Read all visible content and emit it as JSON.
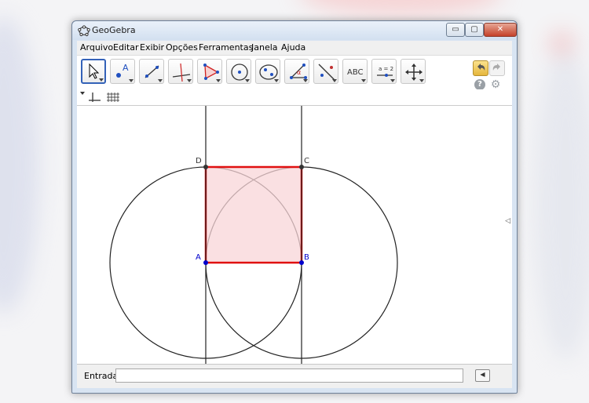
{
  "window": {
    "title": "GeoGebra",
    "controls": {
      "minimize": "▭",
      "maximize": "▢",
      "close": "✕"
    }
  },
  "menu": {
    "items": [
      "Arquivo",
      "Editar",
      "Exibir",
      "Opções",
      "Ferramentas",
      "Janela",
      "Ajuda"
    ]
  },
  "toolbar": {
    "tools": [
      {
        "icon": "move-arrow-icon",
        "active": true
      },
      {
        "icon": "new-point-icon"
      },
      {
        "icon": "line-icon"
      },
      {
        "icon": "perpendicular-line-icon"
      },
      {
        "icon": "polygon-icon"
      },
      {
        "icon": "circle-icon"
      },
      {
        "icon": "ellipse-icon"
      },
      {
        "icon": "angle-icon",
        "symbol": "α"
      },
      {
        "icon": "reflect-icon"
      },
      {
        "icon": "text-icon",
        "label": "ABC"
      },
      {
        "icon": "slider-icon",
        "label": "a = 2"
      },
      {
        "icon": "move-view-icon"
      }
    ],
    "undo_icon": "undo-icon",
    "redo_icon": "redo-icon",
    "help": "?",
    "settings": "⚙"
  },
  "graphics": {
    "points": [
      {
        "name": "A",
        "x": 0,
        "y": 0,
        "color": "#0000cc"
      },
      {
        "name": "B",
        "x": 1,
        "y": 0,
        "color": "#0000cc"
      },
      {
        "name": "C",
        "x": 1,
        "y": 1,
        "color": "#333333"
      },
      {
        "name": "D",
        "x": 0,
        "y": 1,
        "color": "#333333"
      }
    ],
    "polygon": {
      "vertices": [
        "A",
        "B",
        "C",
        "D"
      ],
      "stroke": "#e01010",
      "fill": "#f8d6d8"
    },
    "circles": [
      {
        "center": "A",
        "through": "B"
      },
      {
        "center": "B",
        "through": "A"
      }
    ],
    "vertical_lines": [
      {
        "through": [
          "A",
          "D"
        ]
      },
      {
        "through": [
          "B",
          "C"
        ]
      }
    ]
  },
  "input_bar": {
    "label": "Entrada:",
    "value": ""
  }
}
